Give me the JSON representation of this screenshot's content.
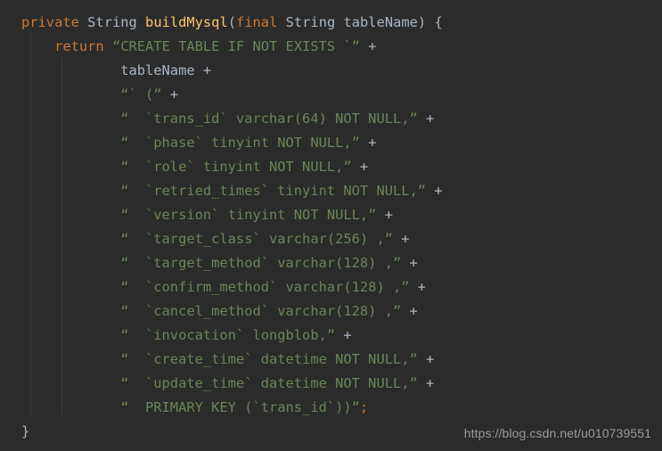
{
  "editor": {
    "theme_name": "darcula",
    "background_color": "#2b2b2b",
    "language": "java",
    "colors": {
      "keyword": "#cc7832",
      "identifier": "#a9b7c6",
      "method_name": "#ffc66d",
      "string": "#6a8759",
      "operator": "#a9b7c6",
      "semicolon": "#cc7832",
      "indent_guide": "#3d3d3d",
      "watermark": "#9b9b9b"
    }
  },
  "code": {
    "lines": [
      {
        "indent": "",
        "tokens": [
          {
            "t": "private",
            "k": "kw"
          },
          {
            "t": " ",
            "k": "punc"
          },
          {
            "t": "String",
            "k": "ident"
          },
          {
            "t": " ",
            "k": "punc"
          },
          {
            "t": "buildMysql",
            "k": "fn"
          },
          {
            "t": "(",
            "k": "punc"
          },
          {
            "t": "final",
            "k": "kw"
          },
          {
            "t": " ",
            "k": "punc"
          },
          {
            "t": "String",
            "k": "ident"
          },
          {
            "t": " tableName",
            "k": "ident"
          },
          {
            "t": ") {",
            "k": "punc"
          }
        ]
      },
      {
        "indent": "    ",
        "tokens": [
          {
            "t": "return",
            "k": "kw"
          },
          {
            "t": " ",
            "k": "punc"
          },
          {
            "t": "“CREATE TABLE IF NOT EXISTS `”",
            "k": "str"
          },
          {
            "t": " +",
            "k": "op"
          }
        ]
      },
      {
        "indent": "            ",
        "tokens": [
          {
            "t": "tableName",
            "k": "ident"
          },
          {
            "t": " +",
            "k": "op"
          }
        ]
      },
      {
        "indent": "            ",
        "tokens": [
          {
            "t": "“` (”",
            "k": "str"
          },
          {
            "t": " +",
            "k": "op"
          }
        ]
      },
      {
        "indent": "            ",
        "tokens": [
          {
            "t": "“  `trans_id` varchar(64) NOT NULL,”",
            "k": "str"
          },
          {
            "t": " +",
            "k": "op"
          }
        ]
      },
      {
        "indent": "            ",
        "tokens": [
          {
            "t": "“  `phase` tinyint NOT NULL,”",
            "k": "str"
          },
          {
            "t": " +",
            "k": "op"
          }
        ]
      },
      {
        "indent": "            ",
        "tokens": [
          {
            "t": "“  `role` tinyint NOT NULL,”",
            "k": "str"
          },
          {
            "t": " +",
            "k": "op"
          }
        ]
      },
      {
        "indent": "            ",
        "tokens": [
          {
            "t": "“  `retried_times` tinyint NOT NULL,”",
            "k": "str"
          },
          {
            "t": " +",
            "k": "op"
          }
        ]
      },
      {
        "indent": "            ",
        "tokens": [
          {
            "t": "“  `version` tinyint NOT NULL,”",
            "k": "str"
          },
          {
            "t": " +",
            "k": "op"
          }
        ]
      },
      {
        "indent": "            ",
        "tokens": [
          {
            "t": "“  `target_class` varchar(256) ,”",
            "k": "str"
          },
          {
            "t": " +",
            "k": "op"
          }
        ]
      },
      {
        "indent": "            ",
        "tokens": [
          {
            "t": "“  `target_method` varchar(128) ,”",
            "k": "str"
          },
          {
            "t": " +",
            "k": "op"
          }
        ]
      },
      {
        "indent": "            ",
        "tokens": [
          {
            "t": "“  `confirm_method` varchar(128) ,”",
            "k": "str"
          },
          {
            "t": " +",
            "k": "op"
          }
        ]
      },
      {
        "indent": "            ",
        "tokens": [
          {
            "t": "“  `cancel_method` varchar(128) ,”",
            "k": "str"
          },
          {
            "t": " +",
            "k": "op"
          }
        ]
      },
      {
        "indent": "            ",
        "tokens": [
          {
            "t": "“  `invocation` longblob,”",
            "k": "str"
          },
          {
            "t": " +",
            "k": "op"
          }
        ]
      },
      {
        "indent": "            ",
        "tokens": [
          {
            "t": "“  `create_time` datetime NOT NULL,”",
            "k": "str"
          },
          {
            "t": " +",
            "k": "op"
          }
        ]
      },
      {
        "indent": "            ",
        "tokens": [
          {
            "t": "“  `update_time` datetime NOT NULL,”",
            "k": "str"
          },
          {
            "t": " +",
            "k": "op"
          }
        ]
      },
      {
        "indent": "            ",
        "tokens": [
          {
            "t": "“  PRIMARY KEY (`trans_id`))”",
            "k": "str"
          },
          {
            "t": ";",
            "k": "semi"
          }
        ]
      },
      {
        "indent": "",
        "tokens": [
          {
            "t": "}",
            "k": "punc"
          }
        ]
      }
    ]
  },
  "watermark": {
    "text": "https://blog.csdn.net/u010739551"
  }
}
